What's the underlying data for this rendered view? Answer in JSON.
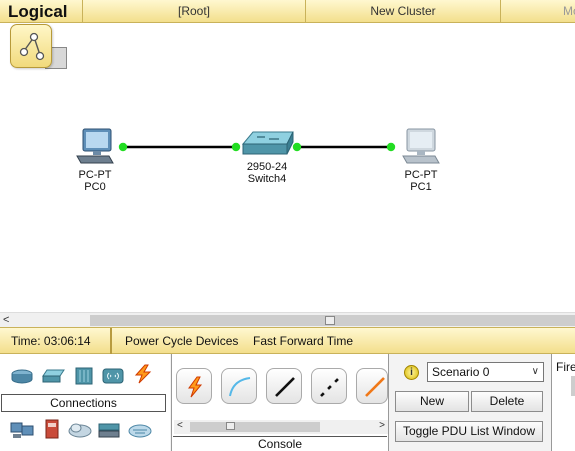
{
  "topbar": {
    "title": "Logical",
    "root_label": "[Root]",
    "cluster_label": "New Cluster",
    "more_label": "Mo"
  },
  "workspace": {
    "devices": [
      {
        "model": "PC-PT",
        "name": "PC0"
      },
      {
        "model": "2950-24",
        "name": "Switch4"
      },
      {
        "model": "PC-PT",
        "name": "PC1"
      }
    ],
    "link_status_color": "#22dd22"
  },
  "timebar": {
    "time_label": "Time: 03:06:14",
    "power_cycle_label": "Power Cycle Devices",
    "fast_forward_label": "Fast Forward Time"
  },
  "device_panel": {
    "top_row_icons": [
      "router-icon",
      "switch-icon",
      "hub-icon",
      "wireless-icon",
      "connections-icon"
    ],
    "category_label": "Connections",
    "bottom_row_icons": [
      "end-devices-icon",
      "security-icon",
      "wan-emulation-icon",
      "custom-devices-icon",
      "multiuser-icon"
    ]
  },
  "cable_panel": {
    "cables": [
      "automatic-cable-icon",
      "console-cable-icon",
      "straight-through-cable-icon",
      "crossover-cable-icon",
      "fiber-cable-icon"
    ],
    "selected_label": "Console"
  },
  "scenario_panel": {
    "scenario_value": "Scenario 0",
    "new_label": "New",
    "delete_label": "Delete",
    "toggle_label": "Toggle PDU List Window"
  },
  "fire_panel": {
    "label": "Fire"
  }
}
